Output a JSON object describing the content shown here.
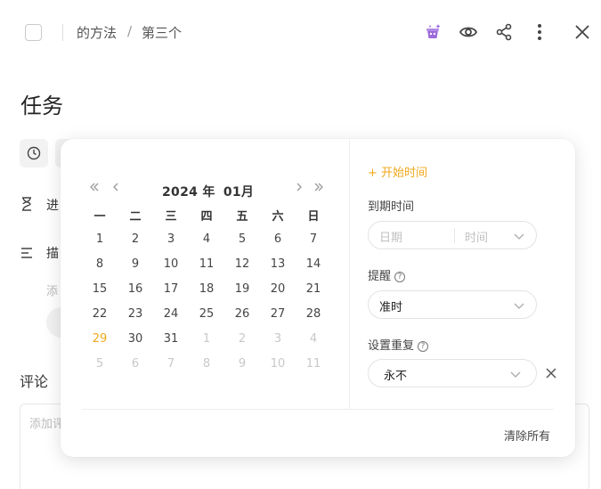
{
  "header": {
    "breadcrumb_parent": "的方法",
    "breadcrumb_sep": "/",
    "breadcrumb_current": "第三个"
  },
  "task": {
    "title": "任务",
    "progress_label": "进",
    "desc_label": "描",
    "add_desc": "添",
    "comments_title": "评论",
    "comment_placeholder": "添加评"
  },
  "calendar": {
    "year_label": "2024 年",
    "month_label": "01月",
    "weekdays": [
      "一",
      "二",
      "三",
      "四",
      "五",
      "六",
      "日"
    ],
    "weeks": [
      [
        [
          "1",
          0
        ],
        [
          "2",
          0
        ],
        [
          "3",
          0
        ],
        [
          "4",
          0
        ],
        [
          "5",
          0
        ],
        [
          "6",
          0
        ],
        [
          "7",
          0
        ]
      ],
      [
        [
          "8",
          0
        ],
        [
          "9",
          0
        ],
        [
          "10",
          0
        ],
        [
          "11",
          0
        ],
        [
          "12",
          0
        ],
        [
          "13",
          0
        ],
        [
          "14",
          0
        ]
      ],
      [
        [
          "15",
          0
        ],
        [
          "16",
          0
        ],
        [
          "17",
          0
        ],
        [
          "18",
          0
        ],
        [
          "19",
          0
        ],
        [
          "20",
          0
        ],
        [
          "21",
          0
        ]
      ],
      [
        [
          "22",
          0
        ],
        [
          "23",
          0
        ],
        [
          "24",
          0
        ],
        [
          "25",
          0
        ],
        [
          "26",
          0
        ],
        [
          "27",
          0
        ],
        [
          "28",
          0
        ]
      ],
      [
        [
          "29",
          2
        ],
        [
          "30",
          0
        ],
        [
          "31",
          0
        ],
        [
          "1",
          1
        ],
        [
          "2",
          1
        ],
        [
          "3",
          1
        ],
        [
          "4",
          1
        ]
      ],
      [
        [
          "5",
          1
        ],
        [
          "6",
          1
        ],
        [
          "7",
          1
        ],
        [
          "8",
          1
        ],
        [
          "9",
          1
        ],
        [
          "10",
          1
        ],
        [
          "11",
          1
        ]
      ]
    ]
  },
  "panel": {
    "start_time": "+ 开始时间",
    "due_label": "到期时间",
    "date_placeholder": "日期",
    "time_placeholder": "时间",
    "reminder_label": "提醒",
    "reminder_value": "准时",
    "repeat_label": "设置重复",
    "repeat_value": "永不",
    "clear_all": "清除所有"
  },
  "colors": {
    "accent": "#f0a81c",
    "ai_icon": "#9b6bdc"
  }
}
